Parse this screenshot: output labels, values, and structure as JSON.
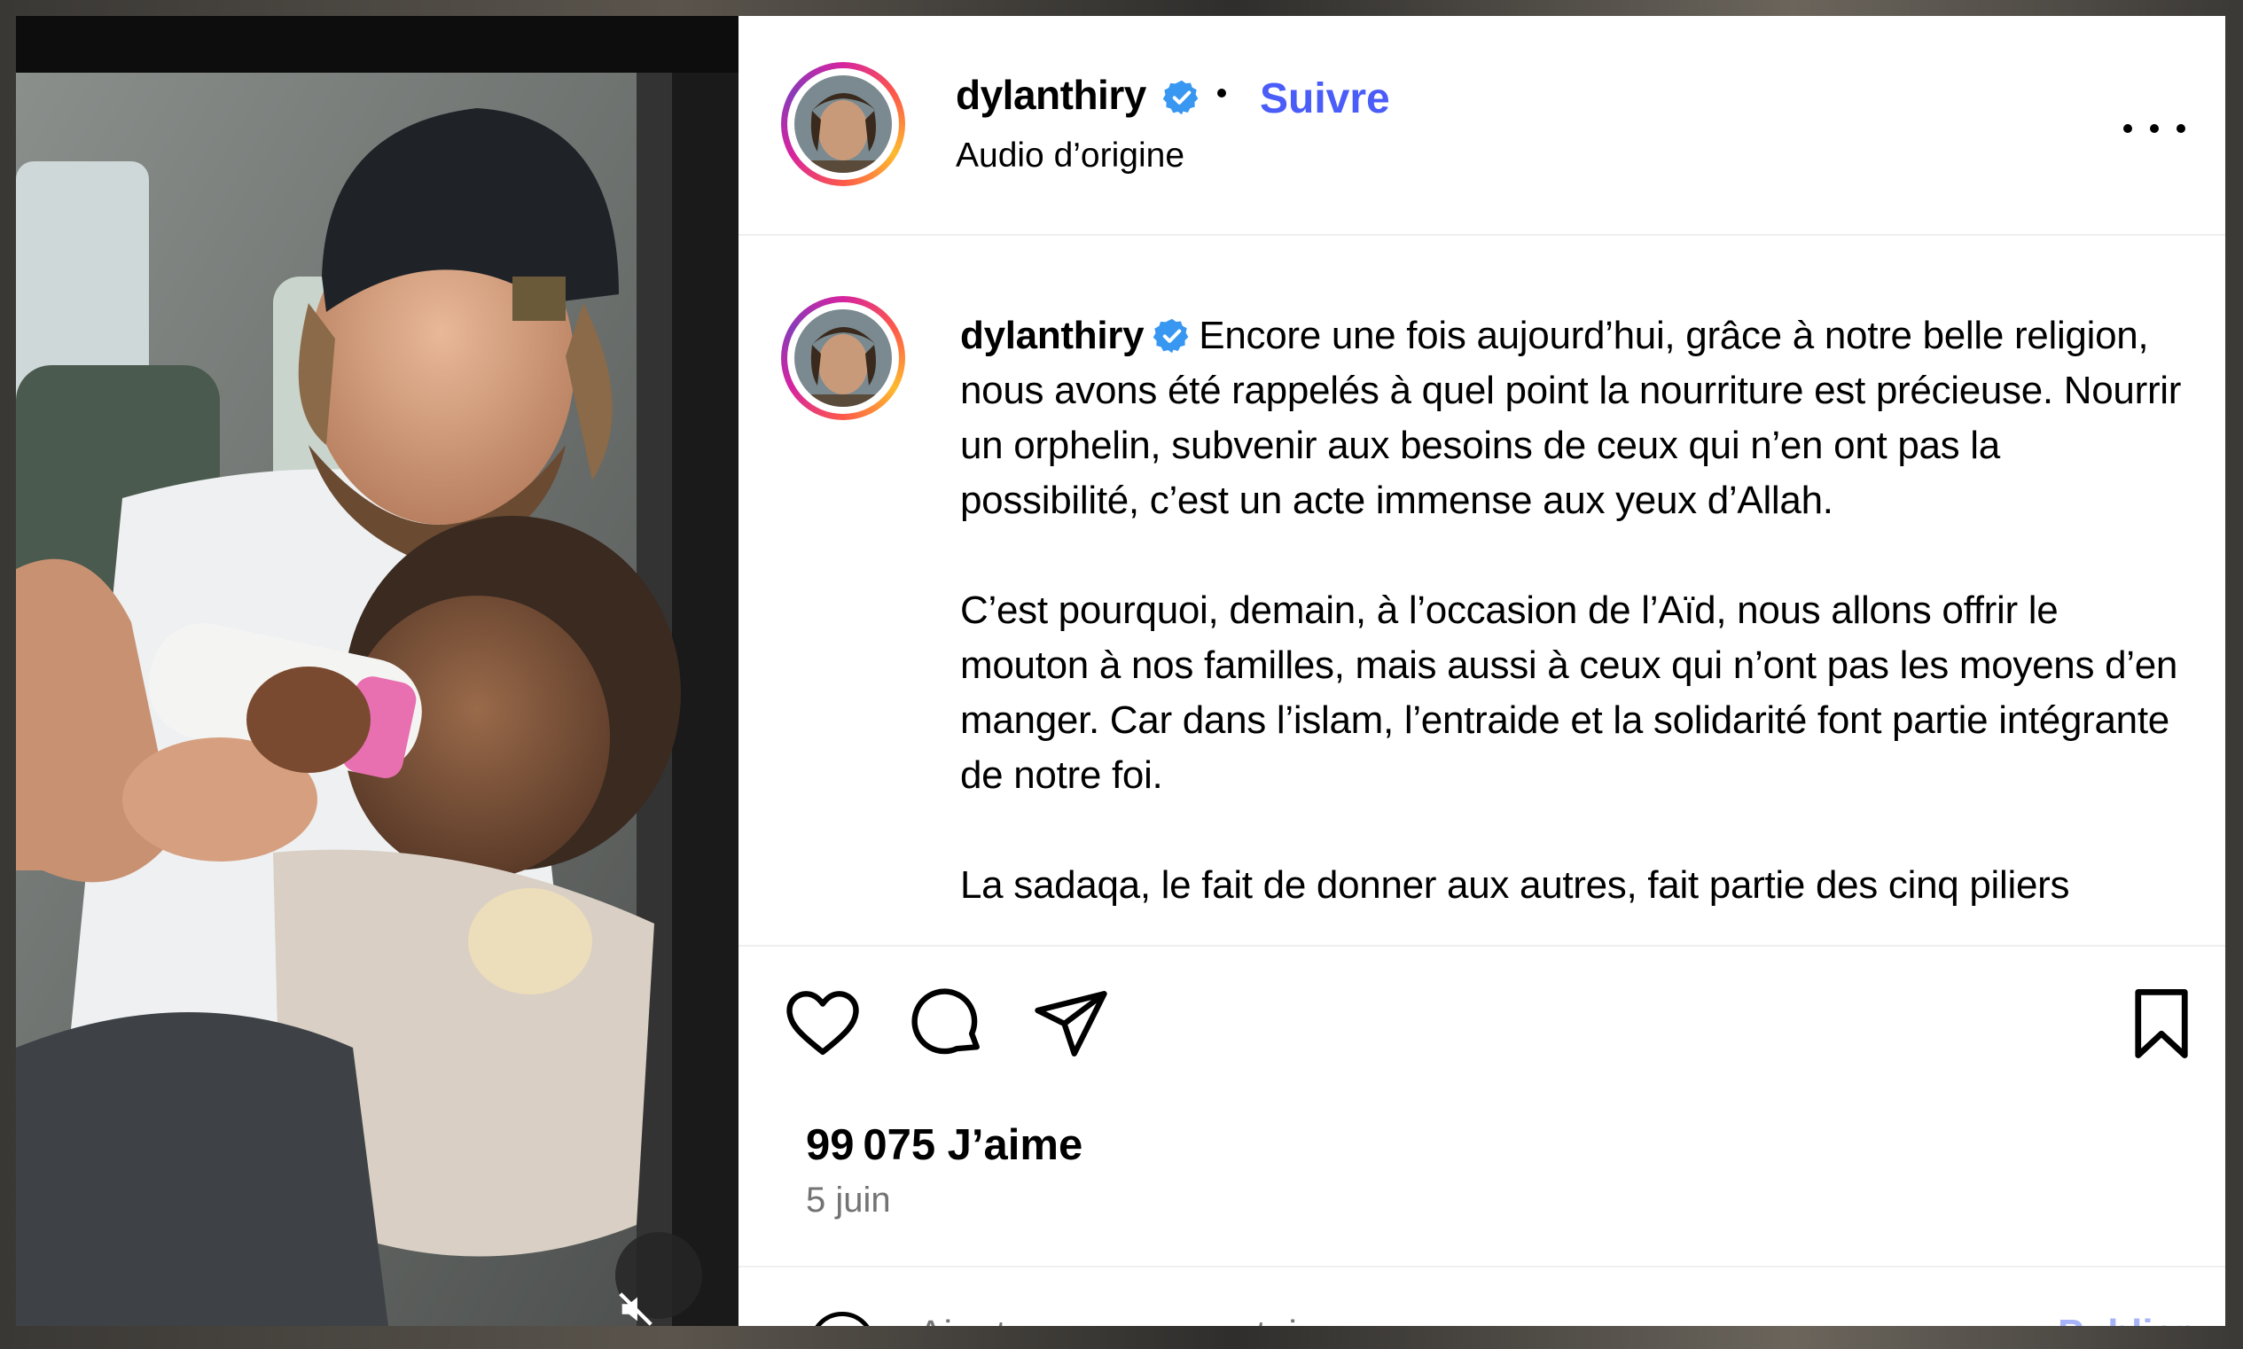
{
  "post": {
    "username": "dylanthiry",
    "follow_label": "Suivre",
    "audio_label": "Audio d’origine",
    "caption_paragraphs": [
      "Encore une fois aujourd’hui, grâce à notre belle religion, nous avons été rappelés à quel point la nourriture est précieuse. Nourrir un orphelin, subvenir aux besoins de ceux qui n’en ont pas la possibilité, c’est un acte immense aux yeux d’Allah.",
      "C’est pourquoi, demain, à l’occasion de l’Aïd, nous allons offrir le mouton à nos familles, mais aussi à ceux qui n’ont pas les moyens d’en manger. Car dans l’islam, l’entraide et la solidarité font partie intégrante de notre foi.",
      "La sadaqa, le fait de donner aux autres, fait partie des cinq piliers"
    ],
    "likes_label": "99 075 J’aime",
    "date_label": "5 juin",
    "comment_placeholder": "Ajouter un commentaire…",
    "publish_label": "Publier"
  },
  "icons": {
    "verified": "verified-badge-icon",
    "more": "more-options-icon",
    "like": "heart-icon",
    "comment": "comment-bubble-icon",
    "share": "paper-plane-icon",
    "save": "bookmark-icon",
    "mute": "speaker-muted-icon",
    "emoji": "emoji-icon"
  },
  "colors": {
    "follow": "#4a5df9",
    "verified": "#3897f0",
    "secondary_text": "#737373",
    "publish": "#a7b5f8"
  }
}
